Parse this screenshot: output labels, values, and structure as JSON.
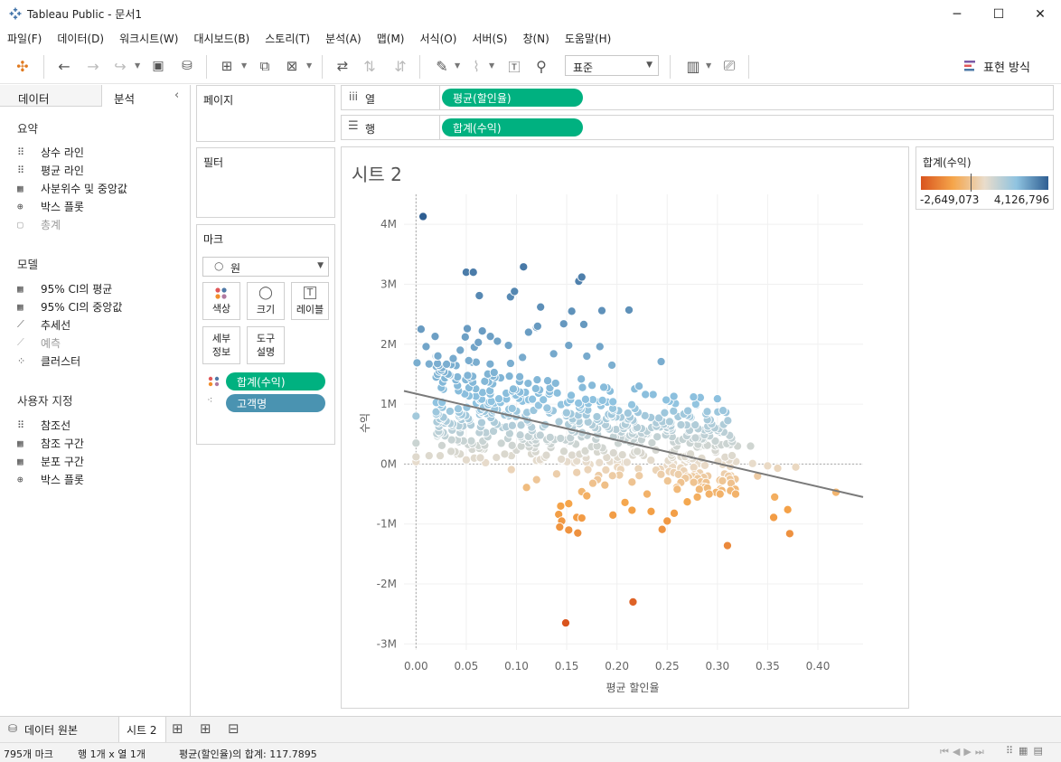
{
  "window": {
    "title": "Tableau Public - 문서1",
    "minimize": "─",
    "maximize": "☐",
    "close": "✕"
  },
  "menu": [
    "파일(F)",
    "데이터(D)",
    "워크시트(W)",
    "대시보드(B)",
    "스토리(T)",
    "분석(A)",
    "맵(M)",
    "서식(O)",
    "서버(S)",
    "창(N)",
    "도움말(H)"
  ],
  "toolbar": {
    "fit_value": "표준",
    "show_me": "표현 방식"
  },
  "left_panel": {
    "tabs": [
      "데이터",
      "분석"
    ],
    "sections": [
      {
        "title": "요약",
        "items": [
          {
            "icon": "⠿",
            "label": "상수 라인",
            "enabled": true
          },
          {
            "icon": "⠿",
            "label": "평균 라인",
            "enabled": true
          },
          {
            "icon": "▦",
            "label": "사분위수 및 중앙값",
            "enabled": true
          },
          {
            "icon": "⊕",
            "label": "박스 플롯",
            "enabled": true
          },
          {
            "icon": "▢",
            "label": "총계",
            "enabled": false
          }
        ]
      },
      {
        "title": "모델",
        "items": [
          {
            "icon": "▦",
            "label": "95% CI의 평균",
            "enabled": true
          },
          {
            "icon": "▦",
            "label": "95% CI의 중앙값",
            "enabled": true
          },
          {
            "icon": "⟋",
            "label": "추세선",
            "enabled": true
          },
          {
            "icon": "⟋",
            "label": "예측",
            "enabled": false
          },
          {
            "icon": "⁘",
            "label": "클러스터",
            "enabled": true
          }
        ]
      },
      {
        "title": "사용자 지정",
        "items": [
          {
            "icon": "⠿",
            "label": "참조선",
            "enabled": true
          },
          {
            "icon": "▦",
            "label": "참조 구간",
            "enabled": true
          },
          {
            "icon": "▦",
            "label": "분포 구간",
            "enabled": true
          },
          {
            "icon": "⊕",
            "label": "박스 플롯",
            "enabled": true
          }
        ]
      }
    ]
  },
  "cards": {
    "pages": "페이지",
    "filters": "필터",
    "marks": "마크",
    "mark_type": "원",
    "mark_buttons": [
      {
        "icon": "⁂",
        "label": "색상"
      },
      {
        "icon": "◯",
        "label": "크기"
      },
      {
        "icon": "T",
        "label": "레이블"
      },
      {
        "icon": "",
        "label": "세부\n정보"
      },
      {
        "icon": "",
        "label": "도구\n설명"
      }
    ],
    "mark_fields": [
      "합계(수익)",
      "고객명"
    ]
  },
  "shelves": {
    "columns_label": "열",
    "rows_label": "행",
    "columns_pill": "평균(할인율)",
    "rows_pill": "합계(수익)"
  },
  "sheet_title": "시트 2",
  "legend": {
    "title": "합계(수익)",
    "min": "-2,649,073",
    "max": "4,126,796",
    "colors": [
      "#d9541e",
      "#f5a54a",
      "#e9dccb",
      "#8fc3e0",
      "#2e5e92"
    ]
  },
  "chart_data": {
    "type": "scatter",
    "xlabel": "평균 할인율",
    "ylabel": "수익",
    "x_ticks": [
      "0.00",
      "0.05",
      "0.10",
      "0.15",
      "0.20",
      "0.25",
      "0.30",
      "0.35",
      "0.40"
    ],
    "y_ticks": [
      "4M",
      "3M",
      "2M",
      "1M",
      "0M",
      "-1M",
      "-2M",
      "-3M"
    ],
    "xlim": [
      -0.012,
      0.445
    ],
    "ylim": [
      -3.1,
      4.5
    ],
    "trendline": {
      "x": [
        -0.012,
        0.445
      ],
      "y": [
        1.22,
        -0.55
      ]
    },
    "points_note": "",
    "points": [
      [
        0.007,
        4.13
      ],
      [
        0.05,
        3.2
      ],
      [
        0.057,
        3.2
      ],
      [
        0.107,
        3.29
      ],
      [
        0.098,
        2.88
      ],
      [
        0.165,
        3.12
      ],
      [
        0.162,
        3.05
      ],
      [
        0.212,
        2.57
      ],
      [
        0.185,
        2.56
      ],
      [
        0.094,
        2.79
      ],
      [
        0.063,
        2.81
      ],
      [
        0.155,
        2.55
      ],
      [
        0.124,
        2.62
      ],
      [
        0.121,
        2.3
      ],
      [
        0.147,
        2.34
      ],
      [
        0.167,
        2.33
      ],
      [
        0.12,
        2.28
      ],
      [
        0.244,
        1.71
      ],
      [
        0.005,
        2.25
      ],
      [
        0.019,
        2.13
      ],
      [
        0.051,
        2.26
      ],
      [
        0.074,
        2.13
      ],
      [
        0.049,
        2.12
      ],
      [
        0.066,
        2.22
      ],
      [
        0.081,
        2.05
      ],
      [
        0.112,
        2.2
      ],
      [
        0.01,
        1.96
      ],
      [
        0.02,
        1.8
      ],
      [
        0.001,
        1.69
      ],
      [
        0.013,
        1.67
      ],
      [
        0.044,
        1.9
      ],
      [
        0.037,
        1.76
      ],
      [
        0.058,
        1.95
      ],
      [
        0.062,
        2.03
      ],
      [
        0.092,
        1.98
      ],
      [
        0.106,
        1.78
      ],
      [
        0.137,
        1.84
      ],
      [
        0.152,
        1.98
      ],
      [
        0.183,
        1.96
      ],
      [
        0.17,
        1.8
      ],
      [
        0.195,
        1.65
      ],
      [
        0.222,
        1.3
      ],
      [
        0.236,
        1.16
      ],
      [
        0.249,
        1.07
      ],
      [
        0.283,
        1.11
      ],
      [
        0.3,
        1.09
      ],
      [
        0.29,
        0.74
      ],
      [
        0.32,
        0.3
      ],
      [
        0.333,
        0.3
      ],
      [
        0.0,
        0.8
      ],
      [
        0.0,
        0.35
      ],
      [
        0.0,
        0.12
      ],
      [
        0.0,
        0.04
      ],
      [
        0.013,
        0.14
      ],
      [
        0.024,
        0.14
      ],
      [
        0.05,
        0.07
      ],
      [
        0.058,
        0.1
      ],
      [
        0.095,
        0.14
      ],
      [
        0.08,
        0.11
      ],
      [
        0.12,
        0.06
      ],
      [
        0.16,
        0.05
      ],
      [
        0.21,
        0.03
      ],
      [
        0.25,
        -0.02
      ],
      [
        0.335,
        0.01
      ],
      [
        0.35,
        -0.03
      ],
      [
        0.36,
        -0.07
      ],
      [
        0.378,
        -0.05
      ],
      [
        0.34,
        -0.2
      ],
      [
        0.357,
        -0.55
      ],
      [
        0.37,
        -0.76
      ],
      [
        0.356,
        -0.89
      ],
      [
        0.372,
        -1.16
      ],
      [
        0.31,
        -1.36
      ],
      [
        0.418,
        -0.47
      ],
      [
        0.27,
        -0.2
      ],
      [
        0.285,
        -0.38
      ],
      [
        0.303,
        -0.42
      ],
      [
        0.26,
        -0.42
      ],
      [
        0.23,
        -0.5
      ],
      [
        0.208,
        -0.64
      ],
      [
        0.215,
        -0.3
      ],
      [
        0.188,
        -0.35
      ],
      [
        0.176,
        -0.32
      ],
      [
        0.165,
        -0.46
      ],
      [
        0.17,
        -0.53
      ],
      [
        0.152,
        -0.66
      ],
      [
        0.144,
        -0.7
      ],
      [
        0.12,
        -0.26
      ],
      [
        0.11,
        -0.39
      ],
      [
        0.142,
        -0.84
      ],
      [
        0.16,
        -0.89
      ],
      [
        0.165,
        -0.9
      ],
      [
        0.145,
        -0.95
      ],
      [
        0.143,
        -1.05
      ],
      [
        0.152,
        -1.1
      ],
      [
        0.161,
        -1.15
      ],
      [
        0.196,
        -0.85
      ],
      [
        0.215,
        -0.77
      ],
      [
        0.234,
        -0.79
      ],
      [
        0.245,
        -1.09
      ],
      [
        0.25,
        -0.95
      ],
      [
        0.257,
        -0.82
      ],
      [
        0.27,
        -0.63
      ],
      [
        0.28,
        -0.55
      ],
      [
        0.29,
        -0.4
      ],
      [
        0.305,
        -0.28
      ],
      [
        0.149,
        -2.65
      ],
      [
        0.216,
        -2.3
      ]
    ]
  },
  "bottom_tabs": {
    "data_source": "데이터 원본",
    "sheet": "시트 2"
  },
  "status": {
    "marks": "795개 마크",
    "rows_cols": "행 1개 x 열 1개",
    "sum": "평균(할인율)의 합계: 117.7895"
  }
}
